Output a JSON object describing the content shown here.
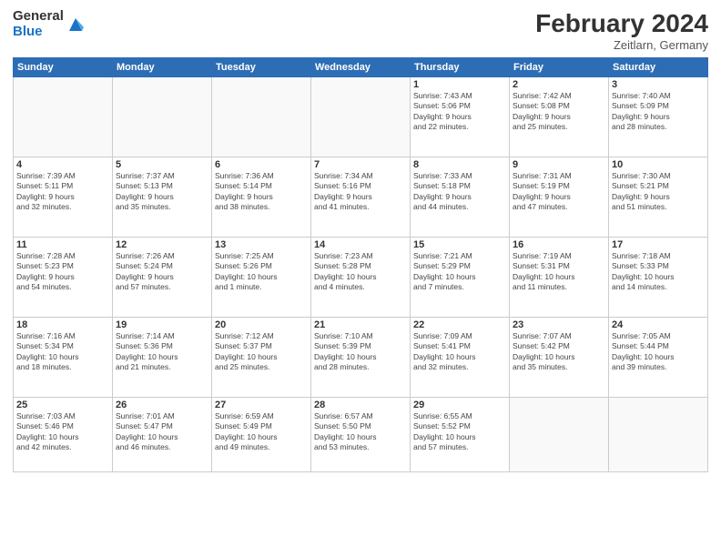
{
  "logo": {
    "general": "General",
    "blue": "Blue"
  },
  "title": "February 2024",
  "subtitle": "Zeitlarn, Germany",
  "headers": [
    "Sunday",
    "Monday",
    "Tuesday",
    "Wednesday",
    "Thursday",
    "Friday",
    "Saturday"
  ],
  "weeks": [
    [
      {
        "day": "",
        "info": ""
      },
      {
        "day": "",
        "info": ""
      },
      {
        "day": "",
        "info": ""
      },
      {
        "day": "",
        "info": ""
      },
      {
        "day": "1",
        "info": "Sunrise: 7:43 AM\nSunset: 5:06 PM\nDaylight: 9 hours\nand 22 minutes."
      },
      {
        "day": "2",
        "info": "Sunrise: 7:42 AM\nSunset: 5:08 PM\nDaylight: 9 hours\nand 25 minutes."
      },
      {
        "day": "3",
        "info": "Sunrise: 7:40 AM\nSunset: 5:09 PM\nDaylight: 9 hours\nand 28 minutes."
      }
    ],
    [
      {
        "day": "4",
        "info": "Sunrise: 7:39 AM\nSunset: 5:11 PM\nDaylight: 9 hours\nand 32 minutes."
      },
      {
        "day": "5",
        "info": "Sunrise: 7:37 AM\nSunset: 5:13 PM\nDaylight: 9 hours\nand 35 minutes."
      },
      {
        "day": "6",
        "info": "Sunrise: 7:36 AM\nSunset: 5:14 PM\nDaylight: 9 hours\nand 38 minutes."
      },
      {
        "day": "7",
        "info": "Sunrise: 7:34 AM\nSunset: 5:16 PM\nDaylight: 9 hours\nand 41 minutes."
      },
      {
        "day": "8",
        "info": "Sunrise: 7:33 AM\nSunset: 5:18 PM\nDaylight: 9 hours\nand 44 minutes."
      },
      {
        "day": "9",
        "info": "Sunrise: 7:31 AM\nSunset: 5:19 PM\nDaylight: 9 hours\nand 47 minutes."
      },
      {
        "day": "10",
        "info": "Sunrise: 7:30 AM\nSunset: 5:21 PM\nDaylight: 9 hours\nand 51 minutes."
      }
    ],
    [
      {
        "day": "11",
        "info": "Sunrise: 7:28 AM\nSunset: 5:23 PM\nDaylight: 9 hours\nand 54 minutes."
      },
      {
        "day": "12",
        "info": "Sunrise: 7:26 AM\nSunset: 5:24 PM\nDaylight: 9 hours\nand 57 minutes."
      },
      {
        "day": "13",
        "info": "Sunrise: 7:25 AM\nSunset: 5:26 PM\nDaylight: 10 hours\nand 1 minute."
      },
      {
        "day": "14",
        "info": "Sunrise: 7:23 AM\nSunset: 5:28 PM\nDaylight: 10 hours\nand 4 minutes."
      },
      {
        "day": "15",
        "info": "Sunrise: 7:21 AM\nSunset: 5:29 PM\nDaylight: 10 hours\nand 7 minutes."
      },
      {
        "day": "16",
        "info": "Sunrise: 7:19 AM\nSunset: 5:31 PM\nDaylight: 10 hours\nand 11 minutes."
      },
      {
        "day": "17",
        "info": "Sunrise: 7:18 AM\nSunset: 5:33 PM\nDaylight: 10 hours\nand 14 minutes."
      }
    ],
    [
      {
        "day": "18",
        "info": "Sunrise: 7:16 AM\nSunset: 5:34 PM\nDaylight: 10 hours\nand 18 minutes."
      },
      {
        "day": "19",
        "info": "Sunrise: 7:14 AM\nSunset: 5:36 PM\nDaylight: 10 hours\nand 21 minutes."
      },
      {
        "day": "20",
        "info": "Sunrise: 7:12 AM\nSunset: 5:37 PM\nDaylight: 10 hours\nand 25 minutes."
      },
      {
        "day": "21",
        "info": "Sunrise: 7:10 AM\nSunset: 5:39 PM\nDaylight: 10 hours\nand 28 minutes."
      },
      {
        "day": "22",
        "info": "Sunrise: 7:09 AM\nSunset: 5:41 PM\nDaylight: 10 hours\nand 32 minutes."
      },
      {
        "day": "23",
        "info": "Sunrise: 7:07 AM\nSunset: 5:42 PM\nDaylight: 10 hours\nand 35 minutes."
      },
      {
        "day": "24",
        "info": "Sunrise: 7:05 AM\nSunset: 5:44 PM\nDaylight: 10 hours\nand 39 minutes."
      }
    ],
    [
      {
        "day": "25",
        "info": "Sunrise: 7:03 AM\nSunset: 5:46 PM\nDaylight: 10 hours\nand 42 minutes."
      },
      {
        "day": "26",
        "info": "Sunrise: 7:01 AM\nSunset: 5:47 PM\nDaylight: 10 hours\nand 46 minutes."
      },
      {
        "day": "27",
        "info": "Sunrise: 6:59 AM\nSunset: 5:49 PM\nDaylight: 10 hours\nand 49 minutes."
      },
      {
        "day": "28",
        "info": "Sunrise: 6:57 AM\nSunset: 5:50 PM\nDaylight: 10 hours\nand 53 minutes."
      },
      {
        "day": "29",
        "info": "Sunrise: 6:55 AM\nSunset: 5:52 PM\nDaylight: 10 hours\nand 57 minutes."
      },
      {
        "day": "",
        "info": ""
      },
      {
        "day": "",
        "info": ""
      }
    ]
  ]
}
